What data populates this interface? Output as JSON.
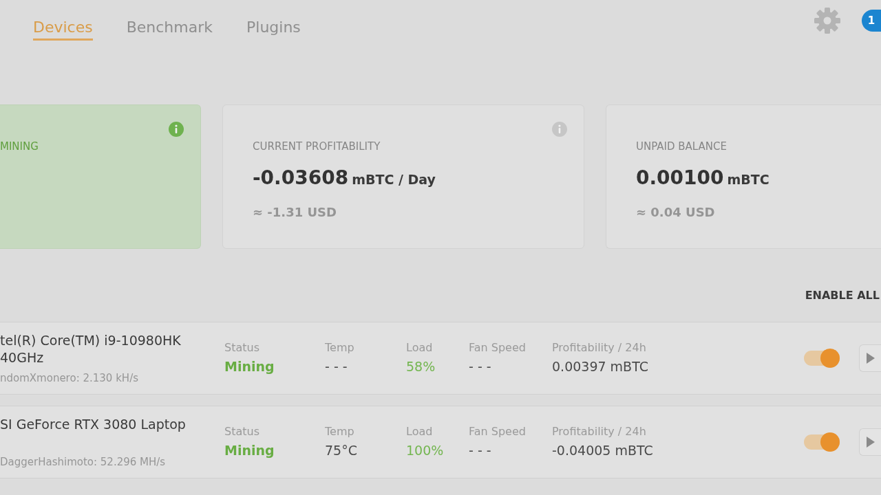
{
  "tabs": [
    {
      "label": "Devices",
      "selected": true
    },
    {
      "label": "Benchmark",
      "selected": false
    },
    {
      "label": "Plugins",
      "selected": false
    }
  ],
  "notifications": {
    "count": "1"
  },
  "cards": [
    {
      "kind": "status",
      "title": "MINING",
      "info": true
    },
    {
      "kind": "stat",
      "title": "CURRENT PROFITABILITY",
      "value": "-0.03608",
      "unit": "mBTC / Day",
      "fiat": "≈ -1.31 USD",
      "info": true
    },
    {
      "kind": "stat",
      "title": "UNPAID BALANCE",
      "value": "0.00100",
      "unit": "mBTC",
      "fiat": "≈ 0.04 USD",
      "info": false
    }
  ],
  "enable_all_button": "ENABLE ALL",
  "devices": [
    {
      "name": "tel(R) Core(TM) i9-10980HK 40GHz",
      "algorithm": "ndomXmonero: 2.130 kH/s",
      "metrics": [
        {
          "kind": "status",
          "label": "Status",
          "value": "Mining"
        },
        {
          "kind": "plain",
          "label": "Temp",
          "value": "- - -"
        },
        {
          "kind": "load",
          "label": "Load",
          "value": "58%"
        },
        {
          "kind": "plain",
          "label": "Fan Speed",
          "value": "- - -"
        },
        {
          "kind": "plain",
          "label": "Profitability / 24h",
          "value": "0.00397 mBTC"
        }
      ],
      "enabled": true
    },
    {
      "name": "SI GeForce RTX 3080 Laptop",
      "algorithm": "DaggerHashimoto: 52.296 MH/s",
      "metrics": [
        {
          "kind": "status",
          "label": "Status",
          "value": "Mining"
        },
        {
          "kind": "plain",
          "label": "Temp",
          "value": "75°C"
        },
        {
          "kind": "load",
          "label": "Load",
          "value": "100%"
        },
        {
          "kind": "plain",
          "label": "Fan Speed",
          "value": "- - -"
        },
        {
          "kind": "plain",
          "label": "Profitability / 24h",
          "value": "-0.04005 mBTC"
        }
      ],
      "enabled": true
    }
  ]
}
